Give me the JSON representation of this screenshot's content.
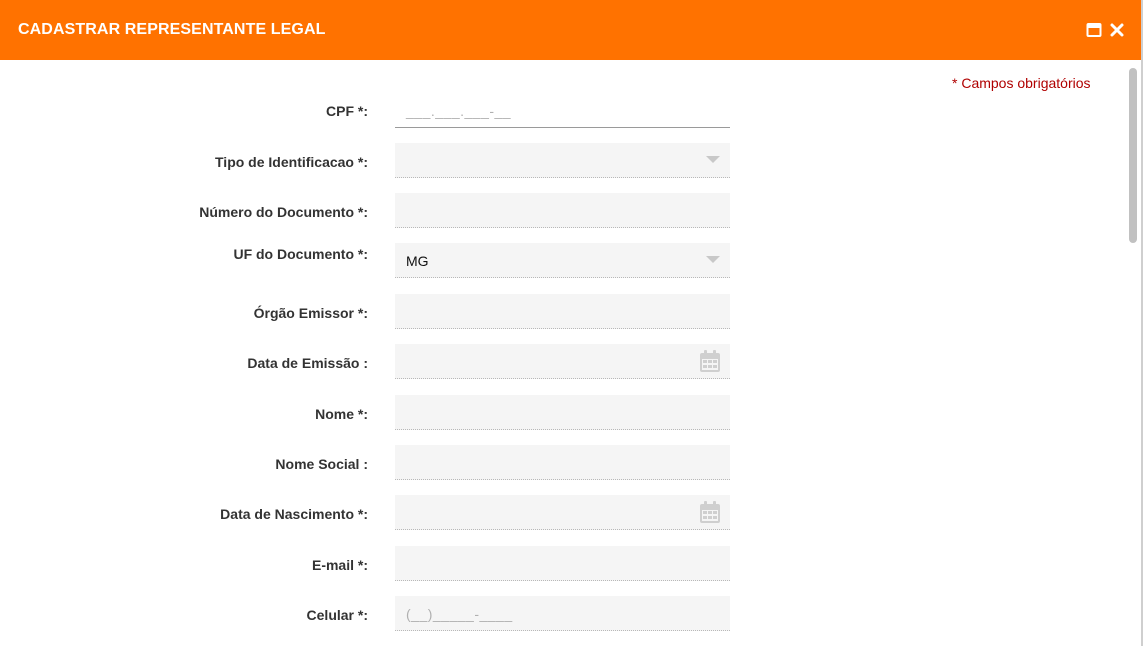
{
  "dialog": {
    "title": "CADASTRAR REPRESENTANTE LEGAL",
    "maximize_icon": "window-maximize-icon",
    "close_icon": "close-icon"
  },
  "required_note": "* Campos obrigatórios",
  "form": {
    "cpf": {
      "label": "CPF *:",
      "placeholder": "___.___.___-__",
      "value": ""
    },
    "tipo_identificacao": {
      "label": "Tipo de Identificacao *:",
      "selected": ""
    },
    "numero_documento": {
      "label": "Número do Documento *:",
      "value": ""
    },
    "uf_documento": {
      "label": "UF do Documento *:",
      "selected": "MG"
    },
    "orgao_emissor": {
      "label": "Órgão Emissor *:",
      "value": ""
    },
    "data_emissao": {
      "label": "Data de Emissão :",
      "value": ""
    },
    "nome": {
      "label": "Nome *:",
      "value": ""
    },
    "nome_social": {
      "label": "Nome Social :",
      "value": ""
    },
    "data_nascimento": {
      "label": "Data de Nascimento *:",
      "value": ""
    },
    "email": {
      "label": "E-mail *:",
      "value": ""
    },
    "celular": {
      "label": "Celular *:",
      "placeholder": "(__)_____-____",
      "value": ""
    }
  },
  "colors": {
    "titlebar": "#ff7200",
    "required_note": "#b00000",
    "field_bg": "#f5f5f5"
  }
}
